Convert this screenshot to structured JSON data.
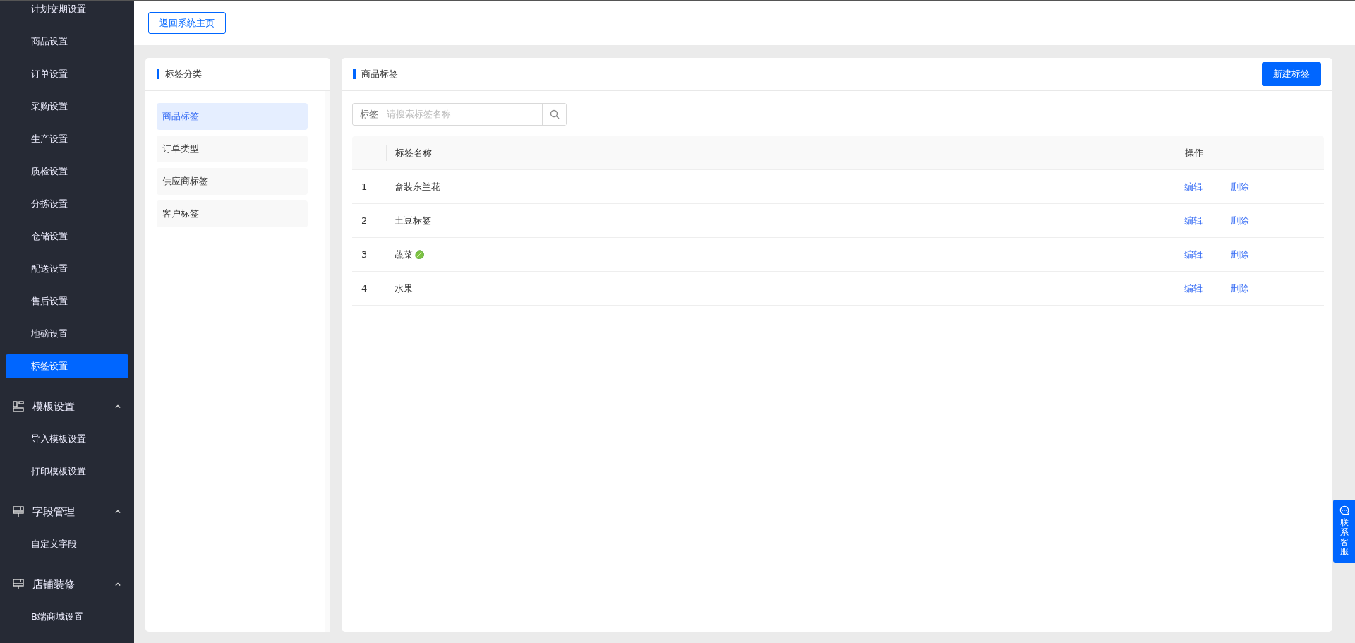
{
  "sidebar": {
    "items": [
      {
        "kind": "item",
        "label": "计划交期设置",
        "selected": false
      },
      {
        "kind": "item",
        "label": "商品设置",
        "selected": false
      },
      {
        "kind": "item",
        "label": "订单设置",
        "selected": false
      },
      {
        "kind": "item",
        "label": "采购设置",
        "selected": false
      },
      {
        "kind": "item",
        "label": "生产设置",
        "selected": false
      },
      {
        "kind": "item",
        "label": "质检设置",
        "selected": false
      },
      {
        "kind": "item",
        "label": "分拣设置",
        "selected": false
      },
      {
        "kind": "item",
        "label": "仓储设置",
        "selected": false
      },
      {
        "kind": "item",
        "label": "配送设置",
        "selected": false
      },
      {
        "kind": "item",
        "label": "售后设置",
        "selected": false
      },
      {
        "kind": "item",
        "label": "地磅设置",
        "selected": false
      },
      {
        "kind": "item",
        "label": "标签设置",
        "selected": true
      },
      {
        "kind": "group",
        "label": "模板设置",
        "expanded": true,
        "children": [
          {
            "label": "导入模板设置",
            "selected": false
          },
          {
            "label": "打印模板设置",
            "selected": false
          }
        ]
      },
      {
        "kind": "group",
        "label": "字段管理",
        "expanded": true,
        "children": [
          {
            "label": "自定义字段",
            "selected": false
          }
        ]
      },
      {
        "kind": "group",
        "label": "店铺装修",
        "expanded": true,
        "children": [
          {
            "label": "B端商城设置",
            "selected": false
          }
        ]
      }
    ]
  },
  "topbar": {
    "back_button": "返回系统主页"
  },
  "category_panel": {
    "title": "标签分类",
    "items": [
      {
        "label": "商品标签",
        "selected": true
      },
      {
        "label": "订单类型",
        "selected": false
      },
      {
        "label": "供应商标签",
        "selected": false
      },
      {
        "label": "客户标签",
        "selected": false
      }
    ]
  },
  "tag_panel": {
    "title": "商品标签",
    "new_button": "新建标签",
    "search": {
      "label": "标签",
      "placeholder": "请搜索标签名称"
    },
    "table": {
      "columns": [
        "标签名称",
        "操作"
      ],
      "rows": [
        {
          "index": "1",
          "name": "盒装东兰花",
          "has_icon": false,
          "actions": [
            "编辑",
            "删除"
          ]
        },
        {
          "index": "2",
          "name": "土豆标签",
          "has_icon": false,
          "actions": [
            "编辑",
            "删除"
          ]
        },
        {
          "index": "3",
          "name": "蔬菜",
          "has_icon": true,
          "actions": [
            "编辑",
            "删除"
          ]
        },
        {
          "index": "4",
          "name": "水果",
          "has_icon": false,
          "actions": [
            "编辑",
            "删除"
          ]
        }
      ]
    }
  },
  "contact_button": "联系客服"
}
